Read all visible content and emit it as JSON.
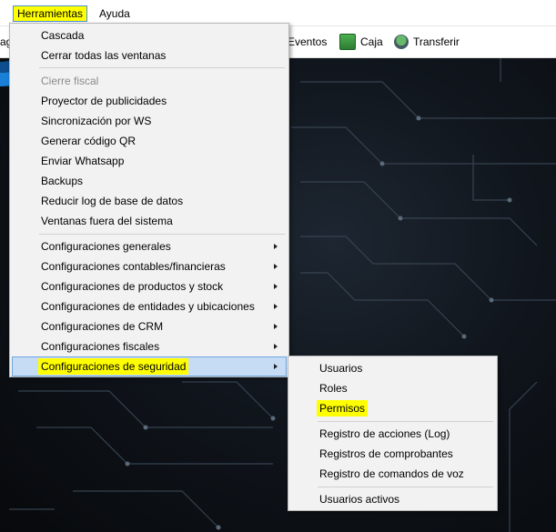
{
  "menubar": {
    "items": [
      {
        "label": "Herramientas",
        "active": true
      },
      {
        "label": "Ayuda",
        "active": false
      }
    ]
  },
  "toolbar": {
    "items": [
      {
        "label": "ag",
        "icon": "calendar-icon"
      },
      {
        "label": "Eventos",
        "icon": "events-icon"
      },
      {
        "label": "Caja",
        "icon": "cash-icon"
      },
      {
        "label": "Transferir",
        "icon": "transfer-icon"
      }
    ]
  },
  "herramientas_menu": {
    "items": [
      {
        "label": "Cascada"
      },
      {
        "label": "Cerrar todas las ventanas"
      },
      {
        "label": "Cierre fiscal",
        "disabled": true
      },
      {
        "label": "Proyector de publicidades"
      },
      {
        "label": "Sincronización por WS"
      },
      {
        "label": "Generar código QR"
      },
      {
        "label": "Enviar Whatsapp"
      },
      {
        "label": "Backups"
      },
      {
        "label": "Reducir log de base de datos"
      },
      {
        "label": "Ventanas fuera del sistema"
      },
      {
        "label": "Configuraciones generales",
        "submenu": true
      },
      {
        "label": "Configuraciones contables/financieras",
        "submenu": true
      },
      {
        "label": "Configuraciones de productos y stock",
        "submenu": true
      },
      {
        "label": "Configuraciones de entidades y ubicaciones",
        "submenu": true
      },
      {
        "label": "Configuraciones de CRM",
        "submenu": true
      },
      {
        "label": "Configuraciones fiscales",
        "submenu": true
      },
      {
        "label": "Configuraciones de seguridad",
        "submenu": true,
        "selected": true,
        "highlighted": true
      }
    ]
  },
  "seguridad_submenu": {
    "items": [
      {
        "label": "Usuarios"
      },
      {
        "label": "Roles"
      },
      {
        "label": "Permisos",
        "highlighted": true
      },
      {
        "label": "Registro de acciones (Log)"
      },
      {
        "label": "Registros de comprobantes"
      },
      {
        "label": "Registro de comandos de voz"
      },
      {
        "label": "Usuarios activos"
      }
    ]
  },
  "colors": {
    "highlight": "#ffff00",
    "selection": "#c6dcf4",
    "menu_bg": "#f2f2f2",
    "background": "#0c0f14",
    "logo": "#1a7fd6"
  }
}
